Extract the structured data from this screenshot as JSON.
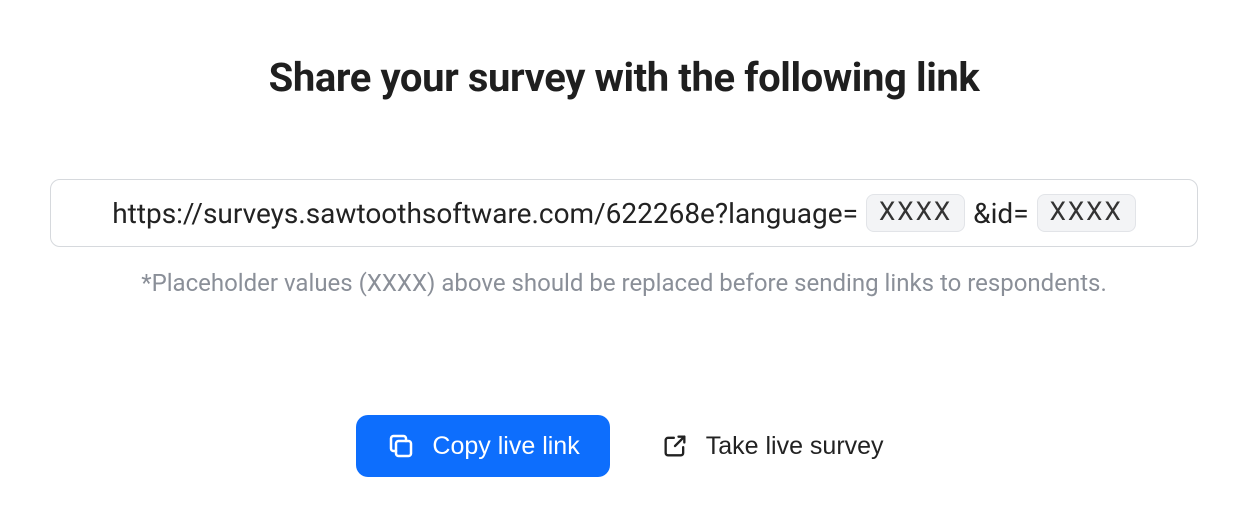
{
  "title": "Share your survey with the following link",
  "url": {
    "part1": "https://surveys.sawtoothsoftware.com/622268e?language=",
    "chip1": "XXXX",
    "part2": "&id=",
    "chip2": "XXXX"
  },
  "helper_text": "*Placeholder values (XXXX) above should be replaced before sending links to respondents.",
  "buttons": {
    "copy_label": "Copy live link",
    "take_label": "Take live survey"
  },
  "colors": {
    "primary": "#0d6efd",
    "text": "#1f1f1f",
    "muted": "#8a8f98",
    "border": "#d6d9dd",
    "chip_bg": "#f3f4f6"
  }
}
